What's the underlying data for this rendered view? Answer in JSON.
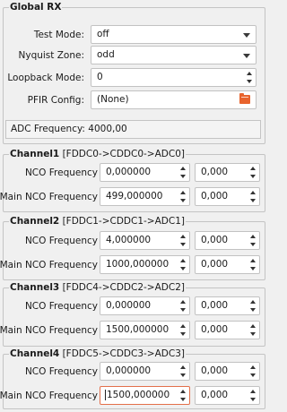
{
  "global_rx": {
    "title": "Global RX",
    "test_mode": {
      "label": "Test Mode:",
      "value": "off"
    },
    "nyquist_zone": {
      "label": "Nyquist Zone:",
      "value": "odd"
    },
    "loopback_mode": {
      "label": "Loopback Mode:",
      "value": "0"
    },
    "pfir_config": {
      "label": "PFIR Config:",
      "value": "(None)"
    },
    "adc_frequency": "ADC Frequency: 4000,00"
  },
  "channels": [
    {
      "title": "Channel1",
      "path": " [FDDC0->CDDC0->ADC0]",
      "nco_label": "NCO Frequency",
      "nco_value": "0,000000",
      "nco_phase": "0,000",
      "main_label": "Main NCO Frequency",
      "main_value": "499,000000",
      "main_phase": "0,000"
    },
    {
      "title": "Channel2",
      "path": " [FDDC1->CDDC1->ADC1]",
      "nco_label": "NCO Frequency",
      "nco_value": "4,000000",
      "nco_phase": "0,000",
      "main_label": "Main NCO Frequency",
      "main_value": "1000,000000",
      "main_phase": "0,000"
    },
    {
      "title": "Channel3",
      "path": " [FDDC4->CDDC2->ADC2]",
      "nco_label": "NCO Frequency",
      "nco_value": "0,000000",
      "nco_phase": "0,000",
      "main_label": "Main NCO Frequency",
      "main_value": "1500,000000",
      "main_phase": "0,000"
    },
    {
      "title": "Channel4",
      "path": " [FDDC5->CDDC3->ADC3]",
      "nco_label": "NCO Frequency",
      "nco_value": "0,000000",
      "nco_phase": "0,000",
      "main_label": "Main NCO Frequency",
      "main_value": "1500,000000",
      "main_phase": "0,000"
    }
  ]
}
